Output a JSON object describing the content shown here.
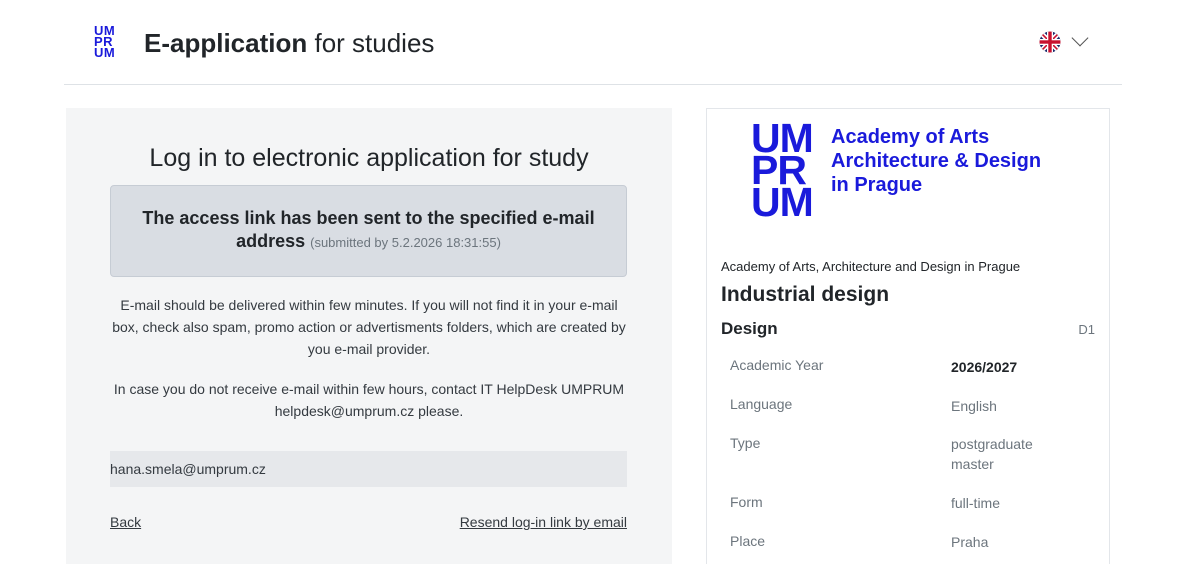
{
  "header": {
    "logo_lines": [
      "UM",
      "PR",
      "UM"
    ],
    "title_bold": "E-application",
    "title_rest": " for studies",
    "language_icon": "uk-flag-icon"
  },
  "login": {
    "title": "Log in to electronic application for study",
    "notice_main": "The access link has been sent to the specified e-mail address",
    "notice_sub": "(submitted by 5.2.2026 18:31:55)",
    "info1": "E-mail should be delivered within few minutes. If you will not find it in your e-mail box, check also spam, promo action or advertisments folders, which are created by you e-mail provider.",
    "info2": "In case you do not receive e-mail within few hours, contact IT HelpDesk UMPRUM helpdesk@umprum.cz please.",
    "email": "hana.smela@umprum.cz",
    "back_label": "Back",
    "resend_label": "Resend log-in link by email"
  },
  "program": {
    "logo_lines": [
      "UM",
      "PR",
      "UM"
    ],
    "academy_lines": [
      "Academy of Arts",
      "Architecture & Design",
      "in Prague"
    ],
    "school": "Academy of Arts, Architecture and Design in Prague",
    "name": "Industrial design",
    "field": "Design",
    "code": "D1",
    "details": [
      {
        "label": "Academic Year",
        "value": "2026/2027"
      },
      {
        "label": "Language",
        "value": "English"
      },
      {
        "label": "Type",
        "value": "postgraduate master"
      },
      {
        "label": "Form",
        "value": "full-time"
      },
      {
        "label": "Place",
        "value": "Praha"
      }
    ]
  },
  "colors": {
    "brand": "#1a1adb",
    "panel": "#f4f5f6",
    "notice": "#d9dde3"
  }
}
